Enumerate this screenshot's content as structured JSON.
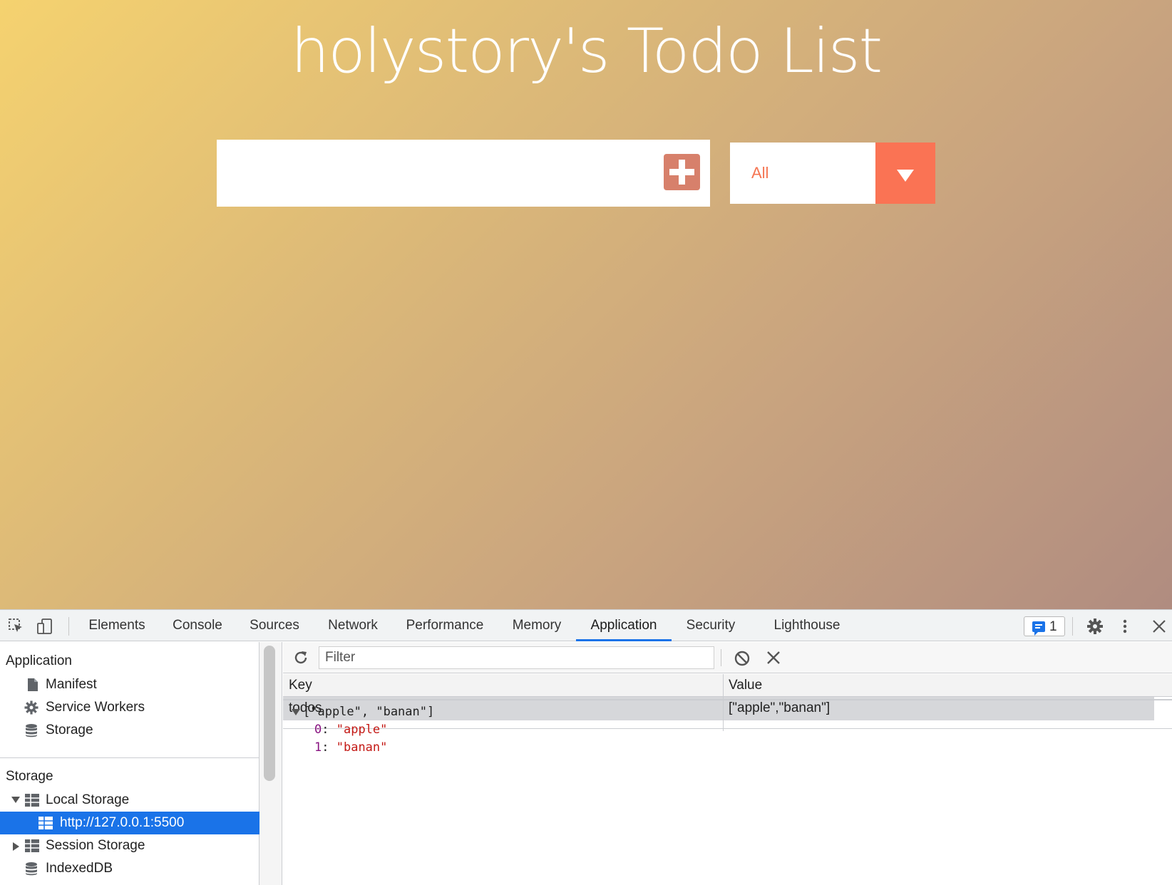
{
  "app": {
    "title": "holystory's Todo List",
    "todo_input": {
      "value": "",
      "placeholder": ""
    },
    "add_button_icon": "plus-square-icon",
    "filter": {
      "selected": "All"
    },
    "colors": {
      "accent": "#fa7354",
      "add_button": "#d7806b",
      "title_text": "#ffffff"
    }
  },
  "devtools": {
    "tabs": [
      "Elements",
      "Console",
      "Sources",
      "Network",
      "Performance",
      "Memory",
      "Application",
      "Security",
      "Lighthouse"
    ],
    "active_tab": "Application",
    "issues_count": "1",
    "sidebar": {
      "application_heading": "Application",
      "application_items": [
        {
          "label": "Manifest",
          "icon": "file-icon"
        },
        {
          "label": "Service Workers",
          "icon": "gear-icon"
        },
        {
          "label": "Storage",
          "icon": "database-icon"
        }
      ],
      "storage_heading": "Storage",
      "local_storage": {
        "label": "Local Storage",
        "icon": "grid-icon",
        "expanded": true
      },
      "local_storage_origin": {
        "label": "http://127.0.0.1:5500",
        "icon": "grid-icon",
        "selected": true
      },
      "session_storage": {
        "label": "Session Storage",
        "icon": "grid-icon",
        "expanded": false
      },
      "indexeddb": {
        "label": "IndexedDB",
        "icon": "database-icon"
      }
    },
    "storage_table": {
      "filter_placeholder": "Filter",
      "columns": [
        "Key",
        "Value"
      ],
      "rows": [
        {
          "key": "todos",
          "value": "[\"apple\",\"banan\"]"
        }
      ]
    },
    "preview": {
      "summary": "[\"apple\", \"banan\"]",
      "items": [
        {
          "index": "0",
          "value": "\"apple\""
        },
        {
          "index": "1",
          "value": "\"banan\""
        }
      ]
    }
  }
}
